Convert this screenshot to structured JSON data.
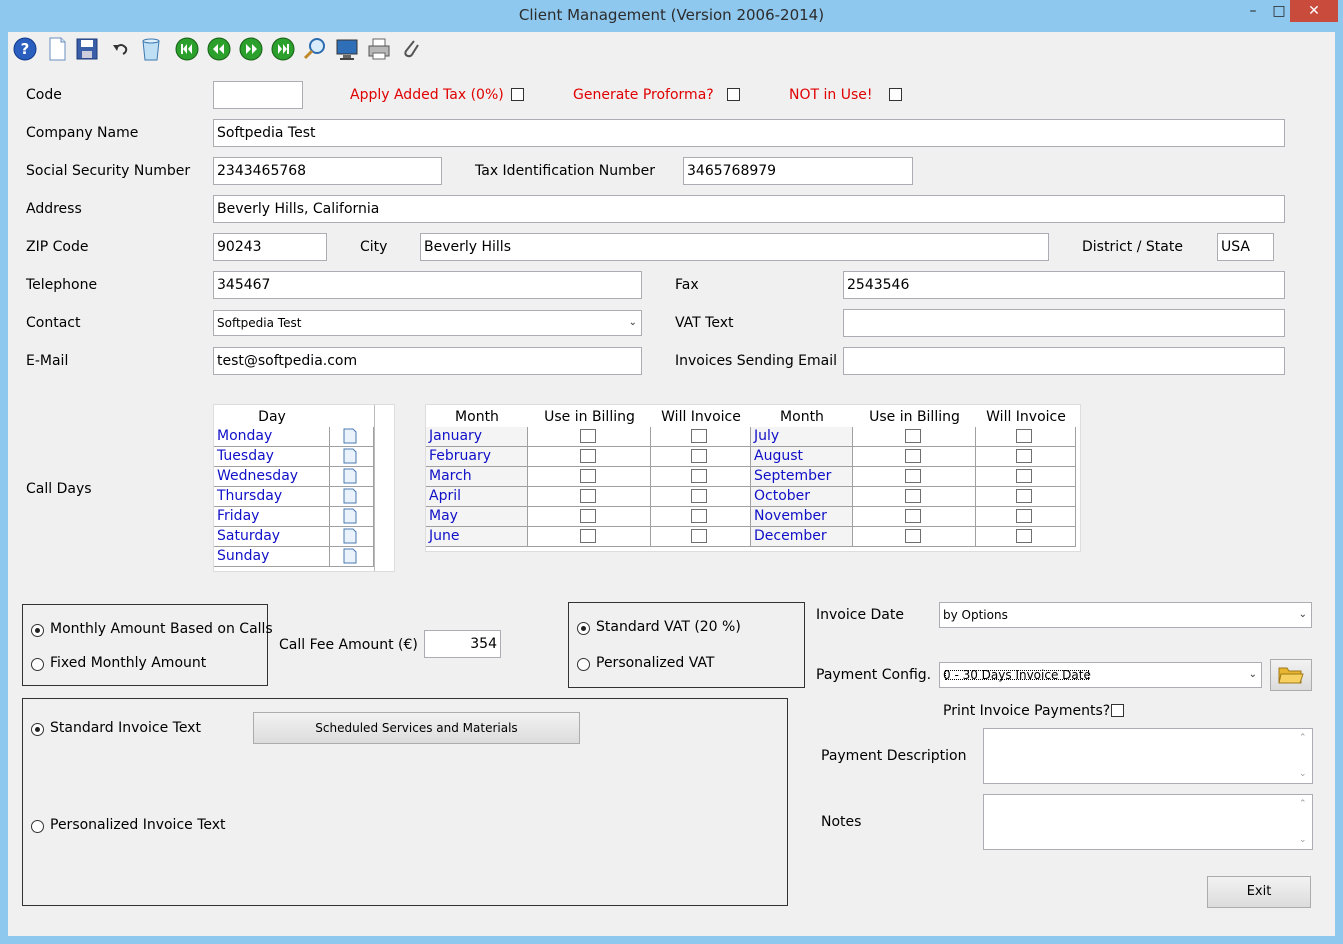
{
  "window": {
    "title": "Client Management (Version 2006-2014)"
  },
  "toolbar": {
    "icons": [
      "help-icon",
      "new-icon",
      "save-icon",
      "undo-icon",
      "delete-icon",
      "first-icon",
      "previous-icon",
      "next-icon",
      "last-icon",
      "search-icon",
      "monitor-icon",
      "print-icon",
      "attach-icon"
    ]
  },
  "form": {
    "code_label": "Code",
    "code_value": "",
    "apply_tax_label": "Apply Added Tax (0%)",
    "proforma_label": "Generate Proforma?",
    "not_in_use_label": "NOT in Use!",
    "company_label": "Company Name",
    "company_value": "Softpedia Test",
    "ssn_label": "Social Security Number",
    "ssn_value": "2343465768",
    "tin_label": "Tax Identification Number",
    "tin_value": "3465768979",
    "address_label": "Address",
    "address_value": "Beverly Hills, California",
    "zip_label": "ZIP Code",
    "zip_value": "90243",
    "city_label": "City",
    "city_value": "Beverly Hills",
    "district_label": "District / State",
    "district_value": "USA",
    "telephone_label": "Telephone",
    "telephone_value": "345467",
    "fax_label": "Fax",
    "fax_value": "2543546",
    "contact_label": "Contact",
    "contact_value": "Softpedia Test",
    "vat_text_label": "VAT Text",
    "vat_text_value": "",
    "email_label": "E-Mail",
    "email_value": "test@softpedia.com",
    "invoice_email_label": "Invoices Sending Email",
    "invoice_email_value": "",
    "call_days_label": "Call Days"
  },
  "days_table": {
    "header": "Day",
    "days": [
      "Monday",
      "Tuesday",
      "Wednesday",
      "Thursday",
      "Friday",
      "Saturday",
      "Sunday"
    ]
  },
  "months_table": {
    "headers": [
      "Month",
      "Use in Billing",
      "Will Invoice",
      "Month",
      "Use in Billing",
      "Will Invoice"
    ],
    "left_months": [
      "January",
      "February",
      "March",
      "April",
      "May",
      "June"
    ],
    "right_months": [
      "July",
      "August",
      "September",
      "October",
      "November",
      "December"
    ]
  },
  "billing": {
    "monthly_calls_label": "Monthly Amount Based on Calls",
    "fixed_monthly_label": "Fixed Monthly Amount",
    "call_fee_label": "Call Fee Amount (€)",
    "call_fee_value": "354",
    "standard_vat_label": "Standard VAT (20 %)",
    "personalized_vat_label": "Personalized VAT",
    "invoice_date_label": "Invoice Date",
    "invoice_date_value": "by Options",
    "payment_config_label": "Payment Config.",
    "payment_config_value": "0 - 30 Days Invoice Date",
    "print_payments_label": "Print Invoice Payments?",
    "standard_invoice_label": "Standard Invoice Text",
    "scheduled_button": "Scheduled Services and Materials",
    "personalized_invoice_label": "Personalized Invoice Text",
    "payment_desc_label": "Payment Description",
    "notes_label": "Notes",
    "exit_button": "Exit"
  }
}
